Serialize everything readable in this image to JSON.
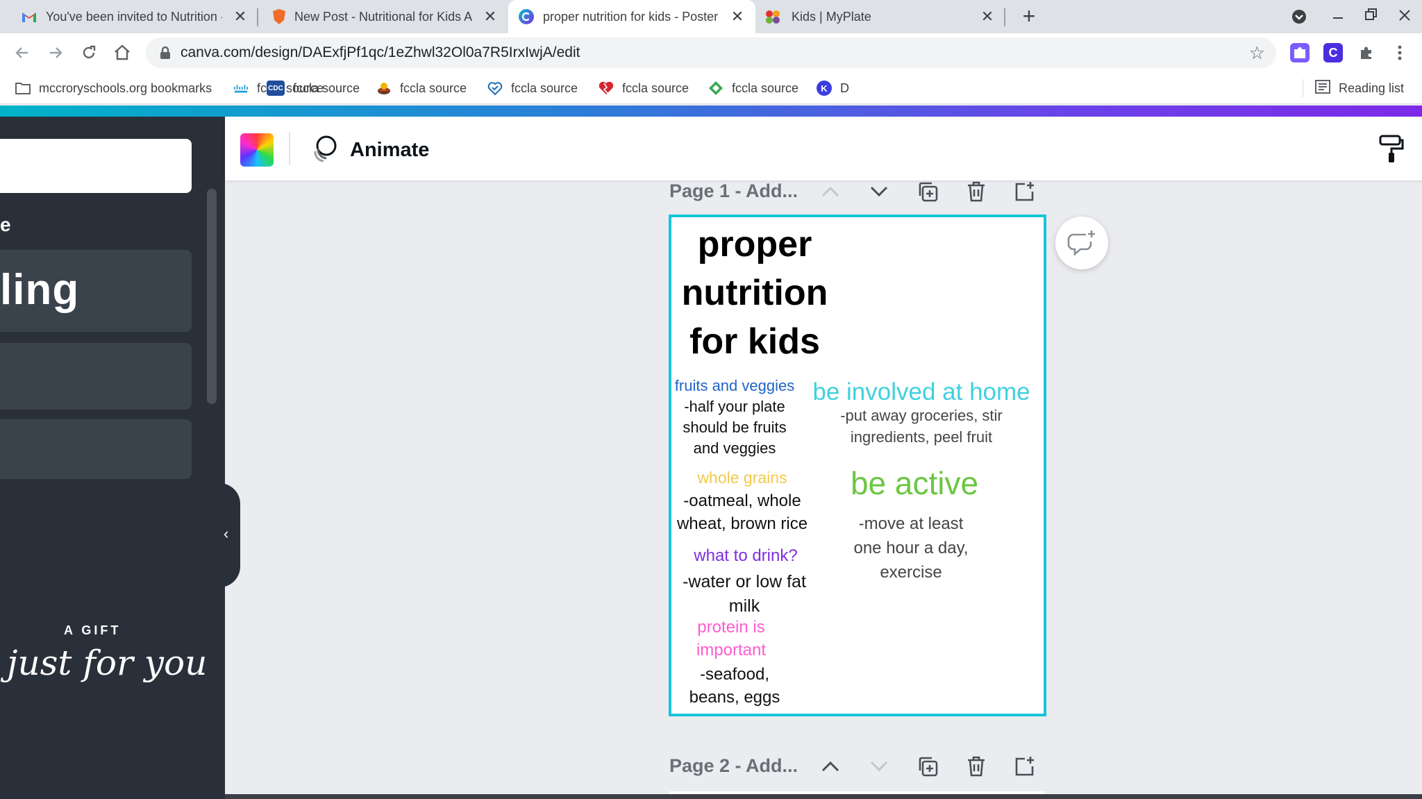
{
  "browser": {
    "tabs": [
      {
        "title": "You've been invited to Nutrition -",
        "favicon": "gmail-icon",
        "close": "✕"
      },
      {
        "title": "New Post - Nutritional for Kids A",
        "favicon": "brave-shield-icon",
        "close": "✕"
      },
      {
        "title": "proper nutrition for kids - Poster",
        "favicon": "canva-icon",
        "close": "✕",
        "active": true
      },
      {
        "title": "Kids | MyPlate",
        "favicon": "myplate-icon",
        "close": "✕"
      }
    ],
    "new_tab": "+",
    "url": "canva.com/design/DAExfjPf1qc/1eZhwl32Ol0a7R5IrxIwjA/edit",
    "bookmarks": [
      {
        "label": "mccroryschools.org bookmarks",
        "icon": "folder-icon"
      },
      {
        "label": "fccla source",
        "icon": "cisco-icon"
      },
      {
        "label": "fccla source",
        "icon": "cdc-icon"
      },
      {
        "label": "fccla source",
        "icon": "food-icon"
      },
      {
        "label": "fccla source",
        "icon": "heart-shield-icon"
      },
      {
        "label": "fccla source",
        "icon": "heart-icon"
      },
      {
        "label": "fccla source",
        "icon": "diamond-icon"
      },
      {
        "label": "D",
        "icon": "k-icon"
      }
    ],
    "reading_list": "Reading list"
  },
  "canva": {
    "animate_label": "Animate",
    "left_panel": {
      "partial_text_1": "e",
      "partial_heading": "ling",
      "gift_line_1": "A GIFT",
      "gift_line_2": "just for you"
    },
    "page1_header": "Page 1 - Add...",
    "page2_header": "Page 2 - Add..."
  },
  "poster": {
    "title_lines": [
      "proper",
      "nutrition",
      "for kids"
    ],
    "sections": {
      "fruits_heading": "fruits and veggies",
      "fruits_body": [
        "-half your plate",
        "should be fruits",
        "and veggies"
      ],
      "grains_heading": "whole grains",
      "grains_body": [
        "-oatmeal, whole",
        "wheat, brown rice"
      ],
      "drink_heading": "what to drink?",
      "drink_body": [
        "-water or low fat",
        "milk"
      ],
      "protein_heading": [
        "protein is",
        "important"
      ],
      "protein_body": [
        "-seafood,",
        "beans, eggs"
      ],
      "involved_heading": "be involved at home",
      "involved_body": [
        "-put away groceries, stir",
        "ingredients, peel fruit"
      ],
      "active_heading": "be active",
      "active_body": [
        "-move at least",
        "one hour a day,",
        "exercise"
      ]
    },
    "colors": {
      "border": "#17c5d8",
      "fruits": "#1f64c7",
      "grains": "#f2c94c",
      "drink": "#7e2ee0",
      "protein": "#ff5ccf",
      "involved": "#3fd0de",
      "active": "#6cc644"
    }
  }
}
